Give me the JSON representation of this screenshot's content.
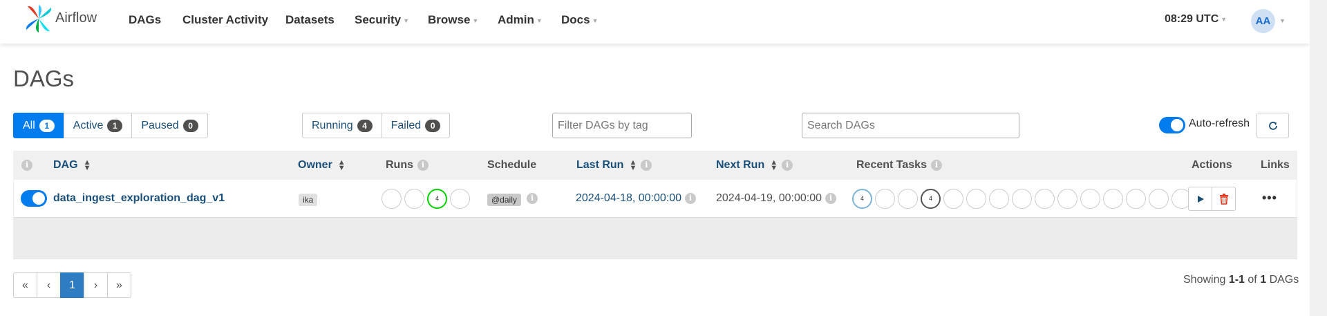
{
  "brand": {
    "name": "Airflow"
  },
  "nav": {
    "items": [
      {
        "label": "DAGs",
        "dropdown": false
      },
      {
        "label": "Cluster Activity",
        "dropdown": false
      },
      {
        "label": "Datasets",
        "dropdown": false
      },
      {
        "label": "Security",
        "dropdown": true
      },
      {
        "label": "Browse",
        "dropdown": true
      },
      {
        "label": "Admin",
        "dropdown": true
      },
      {
        "label": "Docs",
        "dropdown": true
      }
    ],
    "clock": "08:29 UTC",
    "avatar_initials": "AA"
  },
  "page": {
    "title": "DAGs"
  },
  "status_filters": [
    {
      "label": "All",
      "count": "1",
      "active": true
    },
    {
      "label": "Active",
      "count": "1",
      "active": false
    },
    {
      "label": "Paused",
      "count": "0",
      "active": false
    }
  ],
  "run_filters": [
    {
      "label": "Running",
      "count": "4"
    },
    {
      "label": "Failed",
      "count": "0"
    }
  ],
  "tag_filter": {
    "placeholder": "Filter DAGs by tag"
  },
  "search": {
    "placeholder": "Search DAGs"
  },
  "auto_refresh": {
    "label": "Auto-refresh",
    "enabled": true
  },
  "table": {
    "headers": {
      "dag": "DAG",
      "owner": "Owner",
      "runs": "Runs",
      "schedule": "Schedule",
      "last_run": "Last Run",
      "next_run": "Next Run",
      "recent_tasks": "Recent Tasks",
      "actions": "Actions",
      "links": "Links"
    },
    "rows": [
      {
        "dag_id": "data_ingest_exploration_dag_v1",
        "owner": "ika",
        "runs": [
          "",
          "",
          "4",
          ""
        ],
        "schedule": "@daily",
        "last_run": "2024-04-18, 00:00:00",
        "next_run": "2024-04-19, 00:00:00",
        "recent_tasks": [
          "4",
          "",
          "",
          "4",
          "",
          "",
          "",
          "",
          "",
          "",
          "",
          "",
          "",
          "",
          ""
        ]
      }
    ]
  },
  "pagination": {
    "first": "«",
    "prev": "‹",
    "current": "1",
    "next": "›",
    "last": "»"
  },
  "footer": {
    "prefix": "Showing",
    "range": "1-1",
    "of": "of",
    "total": "1",
    "suffix": "DAGs"
  },
  "colors": {
    "primary": "#017cee",
    "running": "#00d000",
    "queued": "#7fb3d6",
    "success_ring": "#555555",
    "delete": "#e43921"
  }
}
